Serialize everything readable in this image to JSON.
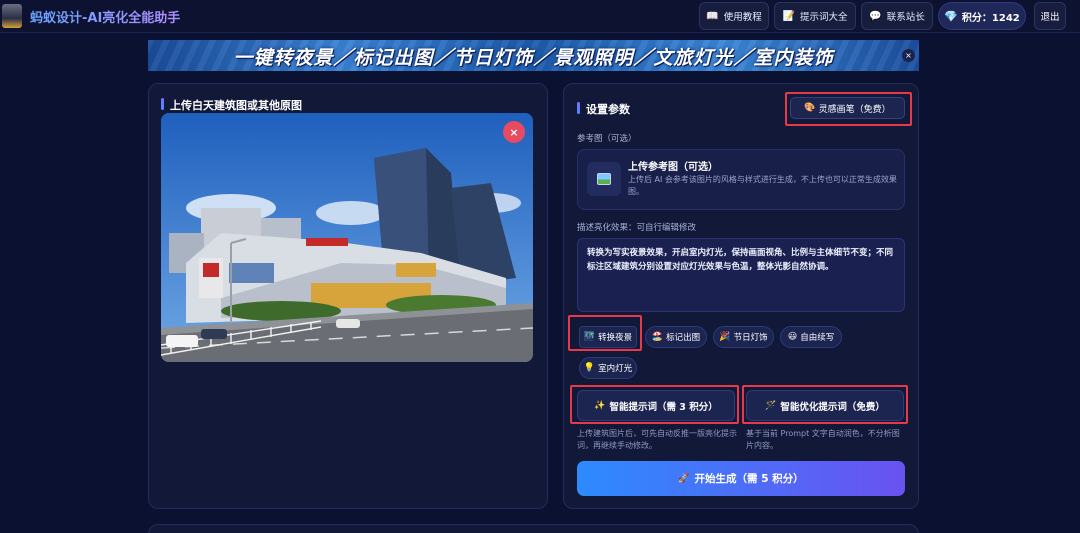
{
  "header": {
    "app_title": "蚂蚁设计-AI亮化全能助手",
    "nav": [
      {
        "icon": "book-icon",
        "glyph": "📖",
        "label": "使用教程"
      },
      {
        "icon": "notepad-icon",
        "glyph": "📝",
        "label": "提示词大全"
      },
      {
        "icon": "chat-bubble-icon",
        "glyph": "💬",
        "label": "联系站长"
      }
    ],
    "points_icon": "💎",
    "points_label": "积分：1242",
    "logout": "退出"
  },
  "banner": {
    "text": "一键转夜景／标记出图／节日灯饰／景观照明／文旅灯光／室内装饰",
    "close": "×"
  },
  "left_panel": {
    "title": "上传白天建筑图或其他原图",
    "remove_icon": "×"
  },
  "right_panel": {
    "title": "设置参数",
    "inspire_button": {
      "icon": "🎨",
      "label": "灵感画笔（免费）"
    },
    "ref_label": "参考图（可选）",
    "ref_title": "上传参考图（可选）",
    "ref_desc": "上传后 AI 会参考该图片的风格与样式进行生成，不上传也可以正常生成效果图。",
    "desc_label": "描述亮化效果：可自行编辑修改",
    "desc_text": "转换为写实夜景效果，开启室内灯光，保持画面视角、比例与主体细节不变；不同标注区域建筑分别设置对应灯光效果与色温，整体光影自然协调。",
    "presets": [
      {
        "icon": "🌃",
        "label": "转换夜景"
      },
      {
        "icon": "🏖️",
        "label": "标记出图"
      },
      {
        "icon": "🎉",
        "label": "节日灯饰"
      },
      {
        "icon": "😃",
        "label": "自由续写"
      },
      {
        "icon": "💡",
        "label": "室内灯光"
      }
    ],
    "smart_prompt": {
      "icon": "✨",
      "label": "智能提示词（需 3 积分）"
    },
    "optimize_prompt": {
      "icon": "🪄",
      "label": "智能优化提示词（免费）"
    },
    "smart_hint": "上传建筑图片后，可先自动反推一版亮化提示词，再继续手动修改。",
    "optimize_hint": "基于当前 Prompt 文字自动润色，不分析图片内容。",
    "generate": {
      "icon": "🚀",
      "label": "开始生成（需 5 积分）"
    }
  },
  "colors": {
    "background": "#0b1130",
    "panel": "#111838",
    "accent_red": "#e8394b",
    "generate_start": "#2d8bff",
    "generate_end": "#6a52f0"
  }
}
